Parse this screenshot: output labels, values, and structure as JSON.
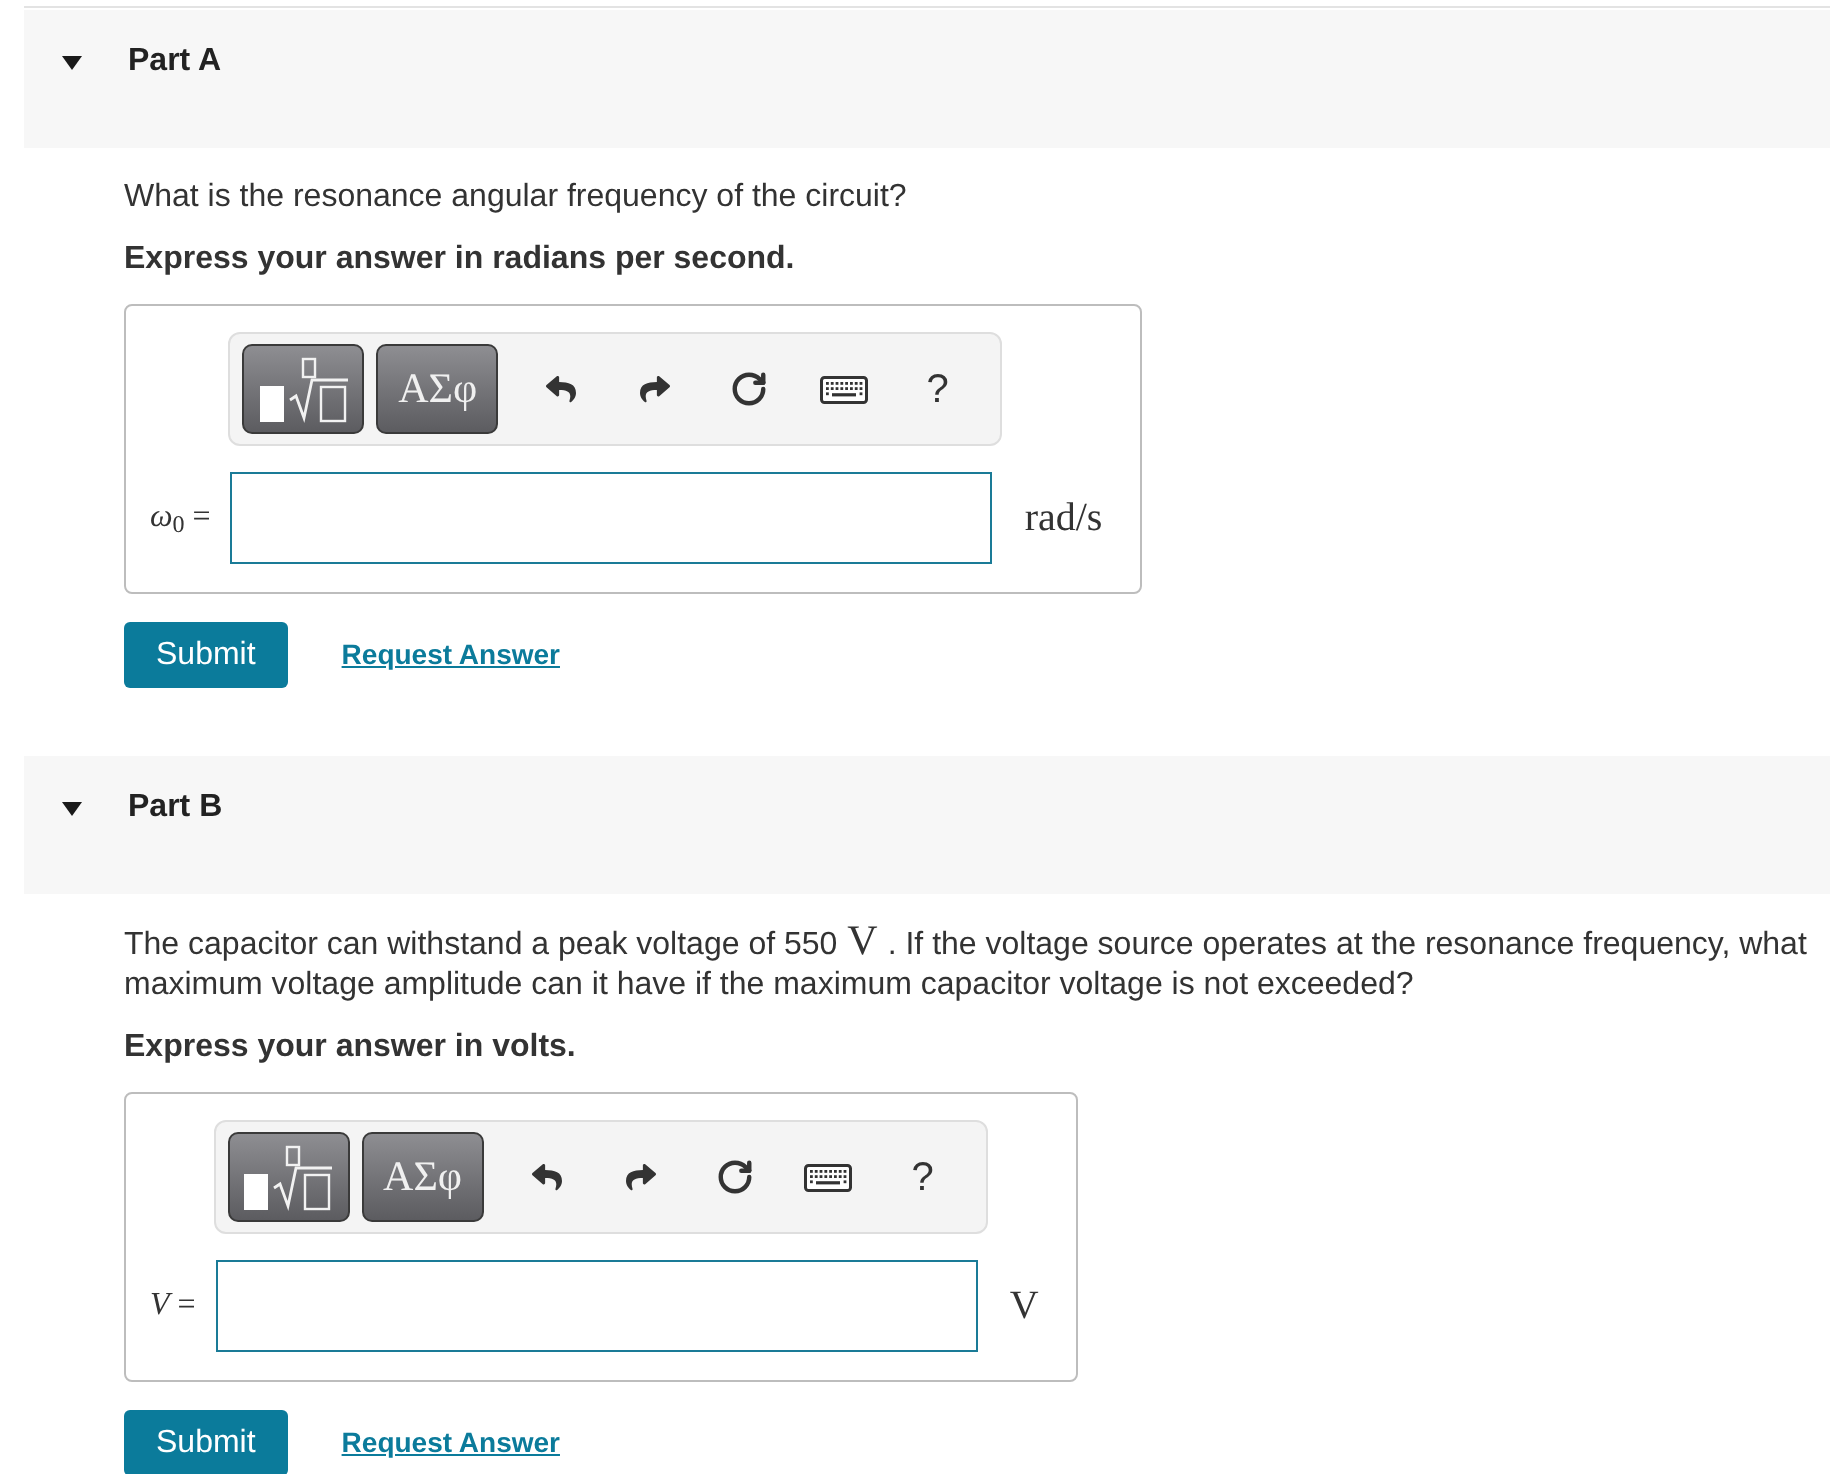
{
  "parts": [
    {
      "title": "Part A",
      "expanded": true,
      "question": [
        {
          "kind": "text",
          "text": "What is the resonance angular frequency of the circuit?"
        }
      ],
      "instruction": "Express your answer in radians per second.",
      "answer": {
        "label": "*ω*$_{0}$ =",
        "unit": "rad/s",
        "toolbar": [
          {
            "kind": "template"
          },
          {
            "kind": "symbols",
            "label": "ΑΣφ"
          },
          {
            "kind": "undo"
          },
          {
            "kind": "redo"
          },
          {
            "kind": "reset"
          },
          {
            "kind": "keyboard"
          },
          {
            "kind": "help",
            "label": "?"
          }
        ]
      },
      "actions": [
        {
          "kind": "submit",
          "label": "Submit"
        },
        {
          "kind": "link",
          "label": "Request Answer"
        }
      ]
    },
    {
      "title": "Part B",
      "expanded": true,
      "question": [
        {
          "kind": "text",
          "text": "The capacitor can withstand a peak voltage of 550"
        },
        {
          "kind": "math",
          "text": "V"
        },
        {
          "kind": "text",
          "text": ". If the voltage source operates at the resonance frequency, what maximum voltage amplitude can it have if the maximum capacitor voltage is not exceeded?"
        }
      ],
      "instruction": "Express your answer in volts.",
      "answer": {
        "label": "*V* =",
        "unit": "V",
        "toolbar": [
          {
            "kind": "template"
          },
          {
            "kind": "symbols",
            "label": "ΑΣφ"
          },
          {
            "kind": "undo"
          },
          {
            "kind": "redo"
          },
          {
            "kind": "reset"
          },
          {
            "kind": "keyboard"
          },
          {
            "kind": "help",
            "label": "?"
          }
        ]
      },
      "actions": [
        {
          "kind": "submit",
          "label": "Submit"
        },
        {
          "kind": "link",
          "label": "Request Answer"
        }
      ]
    }
  ]
}
